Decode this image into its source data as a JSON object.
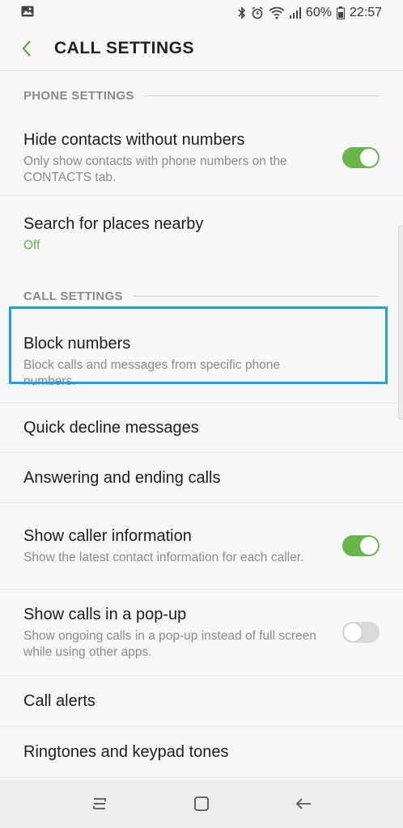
{
  "status_bar": {
    "battery": "60%",
    "time": "22:57",
    "icons": [
      "image-icon",
      "bluetooth-icon",
      "alarm-icon",
      "wifi-icon",
      "signal-icon",
      "battery-icon"
    ]
  },
  "header": {
    "title": "CALL SETTINGS",
    "back_icon": "back-arrow-icon"
  },
  "sections": {
    "phone": {
      "label": "PHONE SETTINGS",
      "hide_contacts": {
        "title": "Hide contacts without numbers",
        "subtitle": "Only show contacts with phone numbers on the CONTACTS tab.",
        "toggle": "on"
      },
      "search_places": {
        "title": "Search for places nearby",
        "status": "Off"
      }
    },
    "call": {
      "label": "CALL SETTINGS",
      "block_numbers": {
        "title": "Block numbers",
        "subtitle": "Block calls and messages from specific phone numbers."
      },
      "quick_decline": {
        "title": "Quick decline messages"
      },
      "answering": {
        "title": "Answering and ending calls"
      },
      "caller_info": {
        "title": "Show caller information",
        "subtitle": "Show the latest contact information for each caller.",
        "toggle": "on"
      },
      "popup": {
        "title": "Show calls in a pop-up",
        "subtitle": "Show ongoing calls in a pop-up instead of full screen while using other apps.",
        "toggle": "off"
      },
      "call_alerts": {
        "title": "Call alerts"
      },
      "ringtones": {
        "title": "Ringtones and keypad tones"
      }
    }
  },
  "colors": {
    "accent_green": "#6ab547",
    "highlight_blue": "#1ea1dc",
    "status_green": "#6ab04c"
  },
  "nav_bar": {
    "icons": [
      "recent-apps-icon",
      "home-icon",
      "back-icon"
    ]
  }
}
